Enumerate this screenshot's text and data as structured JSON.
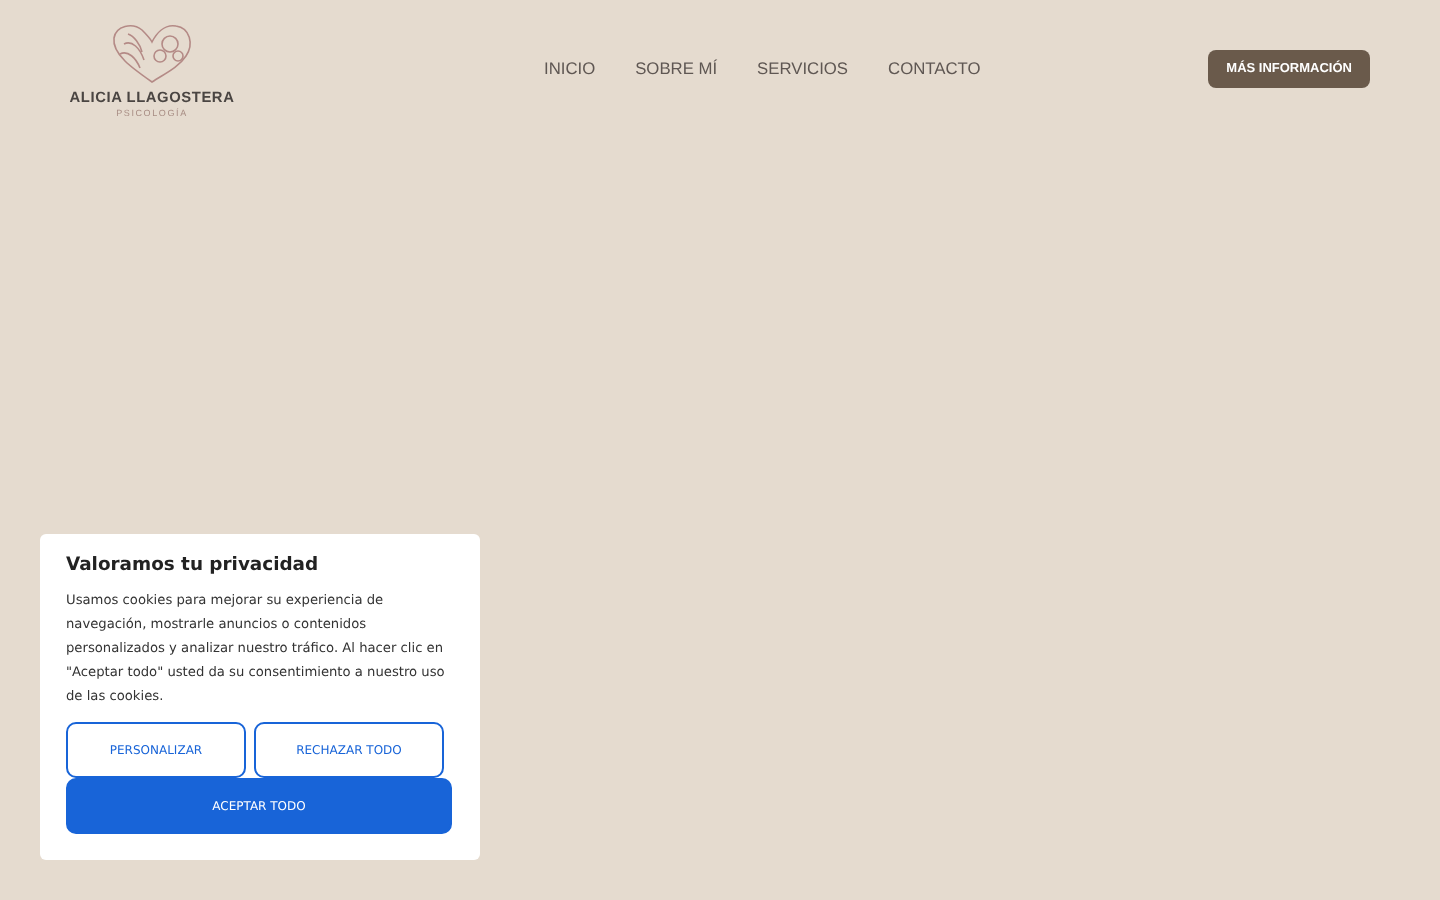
{
  "logo": {
    "name": "ALICIA LLAGOSTERA",
    "tagline": "PSICOLOGÍA"
  },
  "nav": [
    "INICIO",
    "SOBRE MÍ",
    "SERVICIOS",
    "CONTACTO"
  ],
  "cta_button": "MÁS INFORMACIÓN",
  "cookie_banner": {
    "title": "Valoramos tu privacidad",
    "text": "Usamos cookies para mejorar su experiencia de navegación, mostrarle anuncios o contenidos personalizados y analizar nuestro tráfico. Al hacer clic en \"Aceptar todo\" usted da su consentimiento a nuestro uso de las cookies.",
    "buttons": [
      {
        "label": "PERSONALIZAR",
        "kind": "outline"
      },
      {
        "label": "RECHAZAR TODO",
        "kind": "outline"
      },
      {
        "label": "ACEPTAR TODO",
        "kind": "primary"
      }
    ]
  }
}
